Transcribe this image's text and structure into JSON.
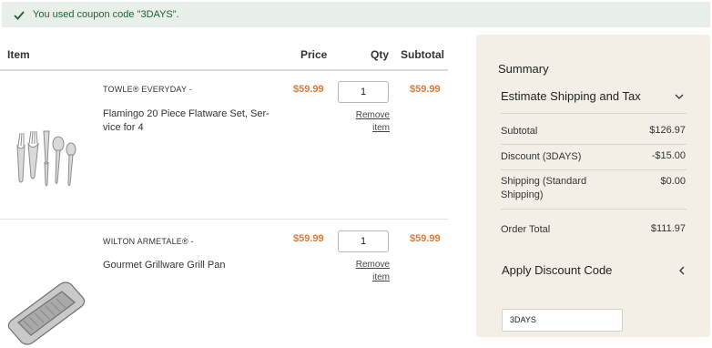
{
  "notice": {
    "message": "You used coupon code \"3DAYS\"."
  },
  "table": {
    "headers": {
      "item": "Item",
      "price": "Price",
      "qty": "Qty",
      "subtotal": "Subtotal"
    },
    "rows": [
      {
        "brand": "TOWLE® EVERYDAY -",
        "name": "Flamingo 20 Piece Flatware Set, Ser- vice for 4",
        "price": "$59.99",
        "qty": "1",
        "subtotal": "$59.99",
        "remove": "Remove item"
      },
      {
        "brand": "WILTON ARMETALE® -",
        "name": "Gourmet Grillware Grill Pan",
        "price": "$59.99",
        "qty": "1",
        "subtotal": "$59.99",
        "remove": "Remove item"
      }
    ]
  },
  "summary": {
    "title": "Summary",
    "estimate": "Estimate Shipping and Tax",
    "rows": [
      {
        "label": "Subtotal",
        "value": "$126.97"
      },
      {
        "label": "Discount (3DAYS)",
        "value": "-$15.00"
      },
      {
        "label": "Shipping (Standard Shipping)",
        "value": "$0.00"
      },
      {
        "label": "Order Total",
        "value": "$111.97"
      }
    ],
    "apply_discount": "Apply Discount Code",
    "coupon_value": "3DAYS"
  },
  "colors": {
    "accent_price": "#e07a35",
    "notice_bg": "#e8efe9",
    "summary_bg": "#f3efe6"
  }
}
